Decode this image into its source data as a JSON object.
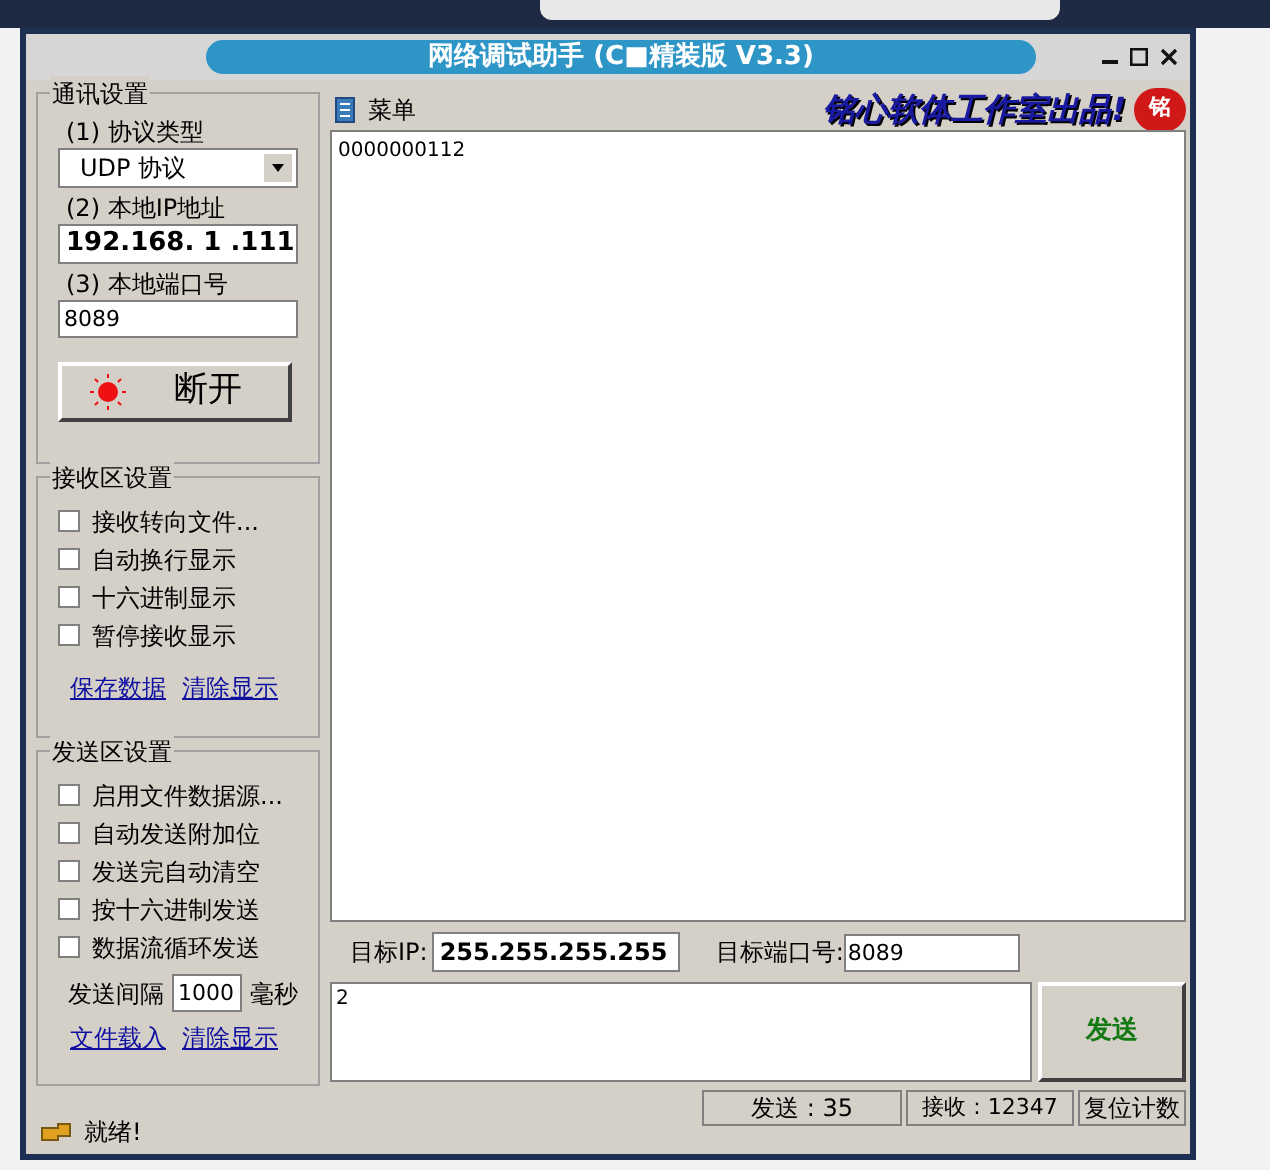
{
  "window": {
    "title": "网络调试助手 (C■精装版 V3.3)"
  },
  "comm_settings": {
    "title": "通讯设置",
    "protocol_label": "(1) 协议类型",
    "protocol": "UDP 协议",
    "local_ip_label": "(2) 本地IP地址",
    "local_ip": "192.168. 1 .111",
    "local_port_label": "(3) 本地端口号",
    "local_port": "8089",
    "connect_button": "断开",
    "connected": true
  },
  "receive_settings": {
    "title": "接收区设置",
    "options": [
      {
        "label": "接收转向文件...",
        "checked": false
      },
      {
        "label": "自动换行显示",
        "checked": false
      },
      {
        "label": "十六进制显示",
        "checked": false
      },
      {
        "label": "暂停接收显示",
        "checked": false
      }
    ],
    "links": [
      "保存数据",
      "清除显示"
    ]
  },
  "send_settings": {
    "title": "发送区设置",
    "options": [
      {
        "label": "启用文件数据源...",
        "checked": false
      },
      {
        "label": "自动发送附加位",
        "checked": false
      },
      {
        "label": "发送完自动清空",
        "checked": false
      },
      {
        "label": "按十六进制发送",
        "checked": false
      },
      {
        "label": "数据流循环发送",
        "checked": false
      }
    ],
    "interval_label": "发送间隔",
    "interval": "1000",
    "interval_unit": "毫秒",
    "links": [
      "文件载入",
      "清除显示"
    ]
  },
  "status": "就绪!",
  "menu": "菜单",
  "brand": "铭心软体工作室出品!",
  "brand_badge": "铭",
  "receive_text": "0000000112",
  "target": {
    "ip_label": "目标IP:",
    "ip": "255.255.255.255",
    "port_label": "目标端口号:",
    "port": "8089"
  },
  "send_text": "2",
  "send_button": "发送",
  "status_bar": {
    "sent": "发送 : 35",
    "received": "接收 : 12347",
    "reset_button": "复位计数"
  }
}
